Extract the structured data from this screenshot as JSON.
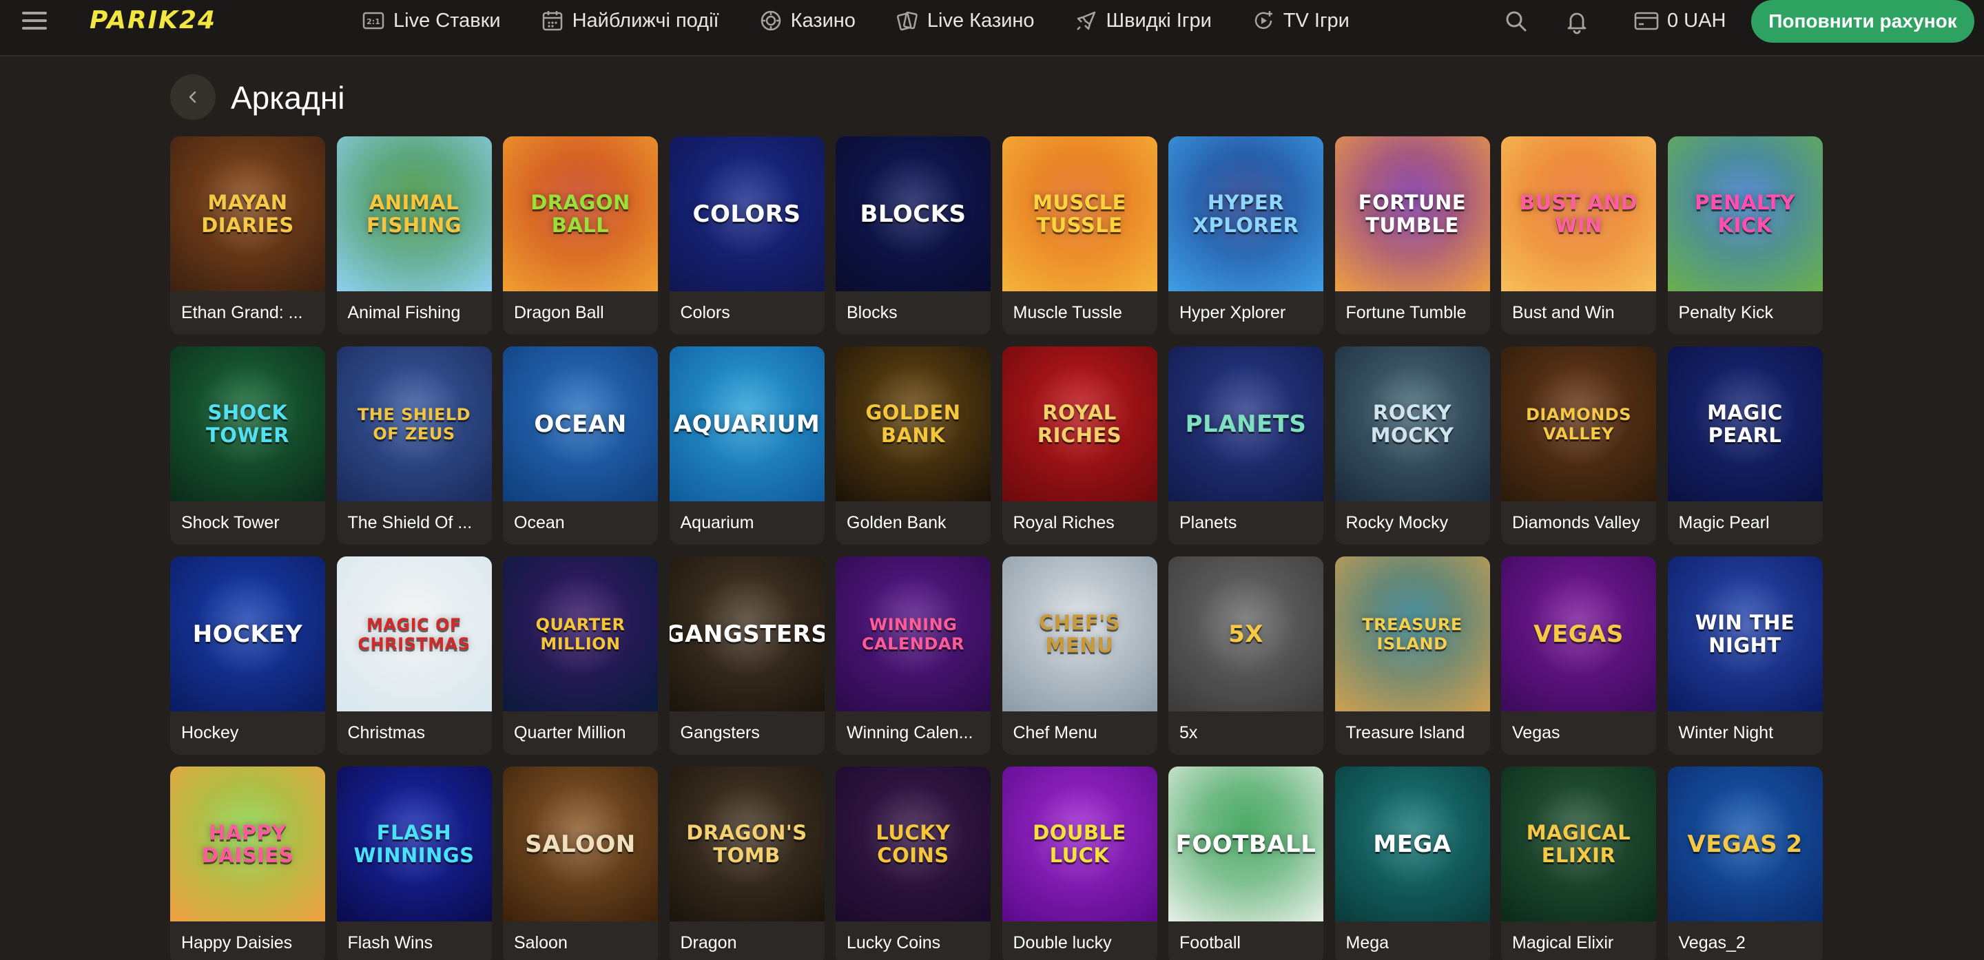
{
  "header": {
    "logo": "PARIK24",
    "nav": [
      {
        "label": "Live Ставки",
        "icon": "live-bets-icon"
      },
      {
        "label": "Найближчі події",
        "icon": "calendar-icon"
      },
      {
        "label": "Казино",
        "icon": "casino-chip-icon"
      },
      {
        "label": "Live Казино",
        "icon": "cards-icon"
      },
      {
        "label": "Швидкі Ігри",
        "icon": "rocket-icon"
      },
      {
        "label": "TV Ігри",
        "icon": "tv-games-icon"
      }
    ],
    "balance": "0 UAH",
    "deposit_label": "Поповнити рахунок"
  },
  "page": {
    "title": "Аркадні"
  },
  "games": [
    {
      "name": "Ethan Grand: ...",
      "art": "Mayan Diaries",
      "bg": "#8a4a1c",
      "bg2": "#3a2010",
      "fg": "#f5c845"
    },
    {
      "name": "Animal Fishing",
      "art": "Animal Fishing",
      "bg": "#3f8f3a",
      "bg2": "#8fd0f0",
      "fg": "#f7c640"
    },
    {
      "name": "Dragon Ball",
      "art": "Dragon Ball",
      "bg": "#c8401c",
      "bg2": "#f0a030",
      "fg": "#9be03a"
    },
    {
      "name": "Colors",
      "art": "Colors",
      "bg": "#1b2a8c",
      "bg2": "#0f1650",
      "fg": "#ffffff"
    },
    {
      "name": "Blocks",
      "art": "Blocks",
      "bg": "#121a5c",
      "bg2": "#090c2c",
      "fg": "#ffffff"
    },
    {
      "name": "Muscle Tussle",
      "art": "Muscle Tussle",
      "bg": "#e26a1a",
      "bg2": "#f6b43a",
      "fg": "#ffd23f"
    },
    {
      "name": "Hyper Xplorer",
      "art": "Hyper Xplorer",
      "bg": "#1b3a8a",
      "bg2": "#3ea0e6",
      "fg": "#8fd6ff"
    },
    {
      "name": "Fortune Tumble",
      "art": "Fortune Tumble",
      "bg": "#7a2fa4",
      "bg2": "#f0a040",
      "fg": "#ffffff"
    },
    {
      "name": "Bust and Win",
      "art": "Bust and Win",
      "bg": "#e8702a",
      "bg2": "#f7c05a",
      "fg": "#ff5fa2"
    },
    {
      "name": "Penalty Kick",
      "art": "Penalty Kick",
      "bg": "#3a78c8",
      "bg2": "#6ab04c",
      "fg": "#ff4fb0"
    },
    {
      "name": "Shock Tower",
      "art": "Shock Tower",
      "bg": "#1a6a3a",
      "bg2": "#0c2a1a",
      "fg": "#53e0f0"
    },
    {
      "name": "The Shield Of ...",
      "art": "The Shield of Zeus",
      "bg": "#3a5aa0",
      "bg2": "#1a2a5a",
      "fg": "#f2c445"
    },
    {
      "name": "Ocean",
      "art": "Ocean",
      "bg": "#2a70c0",
      "bg2": "#0f3d7a",
      "fg": "#ffffff"
    },
    {
      "name": "Aquarium",
      "art": "Aquarium",
      "bg": "#2aa0d8",
      "bg2": "#105a9a",
      "fg": "#ffffff"
    },
    {
      "name": "Golden Bank",
      "art": "Golden Bank",
      "bg": "#6a4a12",
      "bg2": "#1a1208",
      "fg": "#f5c63a"
    },
    {
      "name": "Royal Riches",
      "art": "Royal Riches",
      "bg": "#c0181c",
      "bg2": "#6a0a0c",
      "fg": "#f5d06a"
    },
    {
      "name": "Planets",
      "art": "Planets",
      "bg": "#2a3a8a",
      "bg2": "#101a4a",
      "fg": "#7ee0c0"
    },
    {
      "name": "Rocky Mocky",
      "art": "Rocky Mocky",
      "bg": "#4a6a7a",
      "bg2": "#1a2a3a",
      "fg": "#d0e4f0"
    },
    {
      "name": "Diamonds Valley",
      "art": "Diamonds Valley",
      "bg": "#6a3a1a",
      "bg2": "#2a1a0a",
      "fg": "#f5c845"
    },
    {
      "name": "Magic Pearl",
      "art": "Magic Pearl",
      "bg": "#1a2a7a",
      "bg2": "#0a1040",
      "fg": "#ffffff"
    },
    {
      "name": "Hockey",
      "art": "Hockey",
      "bg": "#1a40b0",
      "bg2": "#0a1a60",
      "fg": "#ffffff"
    },
    {
      "name": "Christmas",
      "art": "Magic of Christmas",
      "bg": "#f2f2f2",
      "bg2": "#d8e8f0",
      "fg": "#d02a2a"
    },
    {
      "name": "Quarter Million",
      "art": "Quarter Million",
      "bg": "#3a1a6a",
      "bg2": "#0a1a3a",
      "fg": "#f5c63a"
    },
    {
      "name": "Gangsters",
      "art": "Gangsters",
      "bg": "#4a3a2a",
      "bg2": "#1a140c",
      "fg": "#ffffff"
    },
    {
      "name": "Winning Calen...",
      "art": "Winning Calendar",
      "bg": "#5a1a8a",
      "bg2": "#2a0a4a",
      "fg": "#ff5a9a"
    },
    {
      "name": "Chef Menu",
      "art": "Chef's Menu",
      "bg": "#d8dde2",
      "bg2": "#8a9aa6",
      "fg": "#c89a3a"
    },
    {
      "name": "5x",
      "art": "5X",
      "bg": "#6a6a6a",
      "bg2": "#3a3a3a",
      "fg": "#f5c845"
    },
    {
      "name": "Treasure Island",
      "art": "Treasure Island",
      "bg": "#2a7a8a",
      "bg2": "#d0a050",
      "fg": "#f5d050"
    },
    {
      "name": "Vegas",
      "art": "Vegas",
      "bg": "#7a1a9a",
      "bg2": "#3a0a5a",
      "fg": "#f5c845"
    },
    {
      "name": "Winter Night",
      "art": "Win the Night",
      "bg": "#2a4ab0",
      "bg2": "#0a1a60",
      "fg": "#ffffff"
    },
    {
      "name": "Happy Daisies",
      "art": "Happy Daisies",
      "bg": "#8ad04a",
      "bg2": "#f0a040",
      "fg": "#ff5aa0"
    },
    {
      "name": "Flash Wins",
      "art": "Flash Winnings",
      "bg": "#1a2ab0",
      "bg2": "#0a0a4a",
      "fg": "#4ae0ff"
    },
    {
      "name": "Saloon",
      "art": "Saloon",
      "bg": "#8a5a2a",
      "bg2": "#3a200a",
      "fg": "#f0e0c0"
    },
    {
      "name": "Dragon",
      "art": "Dragon's Tomb",
      "bg": "#4a3a2a",
      "bg2": "#1a140c",
      "fg": "#f5d070"
    },
    {
      "name": "Lucky Coins",
      "art": "Lucky Coins",
      "bg": "#3a1a4a",
      "bg2": "#1a0a2a",
      "fg": "#f5c63a"
    },
    {
      "name": "Double lucky",
      "art": "Double Luck",
      "bg": "#a02ad0",
      "bg2": "#5a0a8a",
      "fg": "#f5e040"
    },
    {
      "name": "Football",
      "art": "Football",
      "bg": "#2a9a4a",
      "bg2": "#e8f0e8",
      "fg": "#ffffff"
    },
    {
      "name": "Mega",
      "art": "Mega",
      "bg": "#1a7a7a",
      "bg2": "#0a3a3a",
      "fg": "#ffffff"
    },
    {
      "name": "Magical Elixir",
      "art": "Magical Elixir",
      "bg": "#2a5a3a",
      "bg2": "#0a2a1a",
      "fg": "#f5c845"
    },
    {
      "name": "Vegas_2",
      "art": "Vegas 2",
      "bg": "#1a5ab0",
      "bg2": "#0a2a6a",
      "fg": "#f5c845"
    }
  ]
}
